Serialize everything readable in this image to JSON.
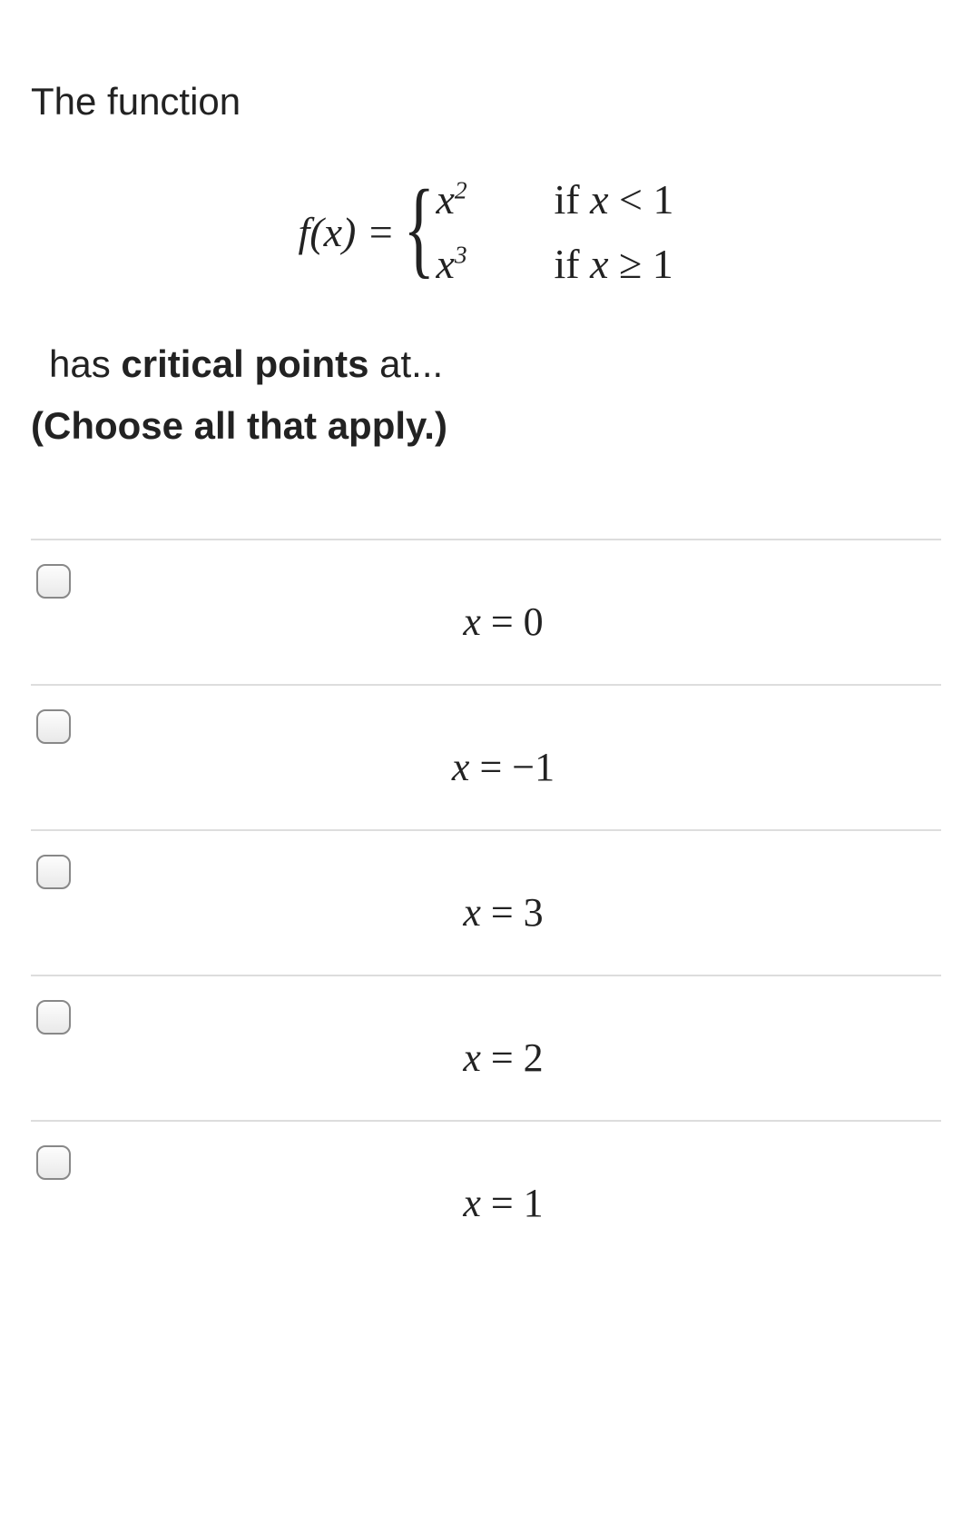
{
  "question": {
    "intro": "The function",
    "formula": {
      "lhs": "f(x) =",
      "cases": [
        {
          "expr_base": "x",
          "expr_exp": "2",
          "cond_prefix": "if  ",
          "cond_var": "x",
          "cond_rel": " < 1"
        },
        {
          "expr_base": "x",
          "expr_exp": "3",
          "cond_prefix": "if  ",
          "cond_var": "x",
          "cond_rel": " ≥ 1"
        }
      ]
    },
    "line2_pre": "has ",
    "line2_bold": "critical points",
    "line2_post": " at...",
    "instruction": "(Choose all that apply.)"
  },
  "options": [
    {
      "var": "x",
      "rest": " = 0"
    },
    {
      "var": "x",
      "rest": " = −1"
    },
    {
      "var": "x",
      "rest": " = 3"
    },
    {
      "var": "x",
      "rest": " = 2"
    },
    {
      "var": "x",
      "rest": " = 1"
    }
  ]
}
